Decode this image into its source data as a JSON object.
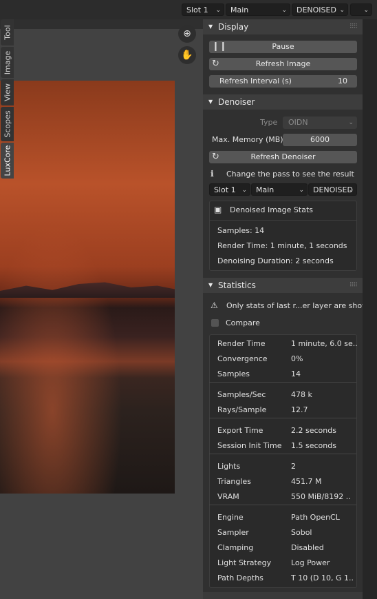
{
  "top_bar": {
    "slot": "Slot 1",
    "layer": "Main",
    "pass": "DENOISED",
    "extra": ""
  },
  "panel": {
    "display": {
      "title": "Display",
      "pause": "Pause",
      "refresh_image": "Refresh Image",
      "refresh_interval_label": "Refresh Interval (s)",
      "refresh_interval_value": "10"
    },
    "denoiser": {
      "title": "Denoiser",
      "type_label": "Type",
      "type_value": "OIDN",
      "max_memory_label": "Max. Memory (MB)",
      "max_memory_value": "6000",
      "refresh_denoiser": "Refresh Denoiser",
      "info": "Change the pass to see the result",
      "slot": "Slot 1",
      "layer": "Main",
      "pass": "DENOISED",
      "stats_title": "Denoised Image Stats",
      "samples": "Samples: 14",
      "render_time": "Render Time: 1 minute, 1 seconds",
      "denoising_duration": "Denoising Duration: 2 seconds"
    },
    "statistics": {
      "title": "Statistics",
      "warning": "Only stats of last r...er layer are shown",
      "compare": "Compare",
      "groups": [
        [
          [
            "Render Time",
            "1 minute, 6.0 se.."
          ],
          [
            "Convergence",
            "0%"
          ],
          [
            "Samples",
            "14"
          ]
        ],
        [
          [
            "Samples/Sec",
            "478 k"
          ],
          [
            "Rays/Sample",
            "12.7"
          ]
        ],
        [
          [
            "Export Time",
            "2.2 seconds"
          ],
          [
            "Session Init Time",
            "1.5 seconds"
          ]
        ],
        [
          [
            "Lights",
            "2"
          ],
          [
            "Triangles",
            "451.7 M"
          ],
          [
            "VRAM",
            "550 MiB/8192 .."
          ]
        ],
        [
          [
            "Engine",
            "Path OpenCL"
          ],
          [
            "Sampler",
            "Sobol"
          ],
          [
            "Clamping",
            "Disabled"
          ],
          [
            "Light Strategy",
            "Log Power"
          ],
          [
            "Path Depths",
            "T 10 (D 10, G 1.."
          ]
        ]
      ]
    }
  },
  "tabs": [
    "Tool",
    "Image",
    "View",
    "Scopes",
    "LuxCore"
  ],
  "colors": {
    "panel_bg": "#303030",
    "header_bg": "#3d3d3d",
    "button_bg": "#565656"
  }
}
